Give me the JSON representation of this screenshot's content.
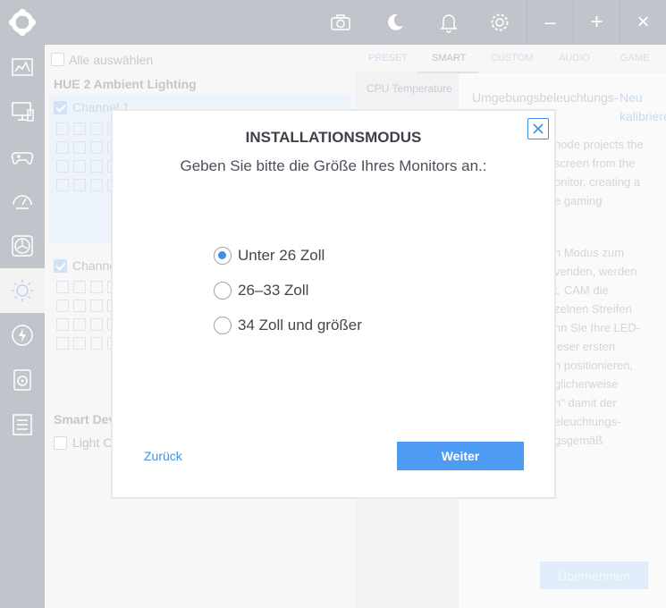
{
  "window": {
    "icons": [
      "camera-icon",
      "moon-icon",
      "bell-icon",
      "gear-icon"
    ],
    "controls": {
      "minimize": "–",
      "maximize": "+",
      "close": "×"
    }
  },
  "sidebar": {
    "items": [
      "dashboard-icon",
      "pc-monitor-icon",
      "gamepad-icon",
      "gauge-icon",
      "fan-icon",
      "lighting-icon",
      "power-icon",
      "speaker-icon",
      "checklist-icon"
    ],
    "active": "lighting-icon"
  },
  "devices": {
    "select_all": "Alle auswählen",
    "group_title": "HUE 2 Ambient Lighting",
    "channel1": "Channel 1",
    "channel2": "Channe",
    "smart_devices": "Smart Dev",
    "light_c": "Light C"
  },
  "tabs": [
    {
      "label": "PRESET",
      "active": false
    },
    {
      "label": "SMART",
      "active": true
    },
    {
      "label": "CUSTOM",
      "active": false
    },
    {
      "label": "AUDIO",
      "active": false
    },
    {
      "label": "GAME",
      "active": false
    }
  ],
  "right_panel": {
    "fx_item": "CPU Temperature",
    "title": "Umgebungsbeleuchtungs-",
    "recalibrate_line1": "Neu",
    "recalibrate_line2": "kalibrieren",
    "para1": [
      "node projects the",
      "screen from the",
      "onitor, creating a",
      "e gaming"
    ],
    "para2": [
      "n Modus zum",
      "venden, werden",
      "t, CAM die",
      "zelnen Streifen",
      "nn Sie Ihre LED-",
      "ieser ersten",
      "n positionieren,",
      "glicherweise",
      "n\" damit der",
      "eleuchtungs-",
      "gsgemäß"
    ],
    "apply": "Übernehmen"
  },
  "modal": {
    "title": "INSTALLATIONSMODUS",
    "subtitle": "Geben Sie bitte die Größe Ihres Monitors an.:",
    "options": [
      {
        "label": "Unter 26 Zoll",
        "selected": true
      },
      {
        "label": "26–33 Zoll",
        "selected": false
      },
      {
        "label": "34 Zoll und größer",
        "selected": false
      }
    ],
    "back": "Zurück",
    "next": "Weiter"
  },
  "colors": {
    "accent": "#4d9bf3",
    "chrome": "#c1c4ca"
  }
}
